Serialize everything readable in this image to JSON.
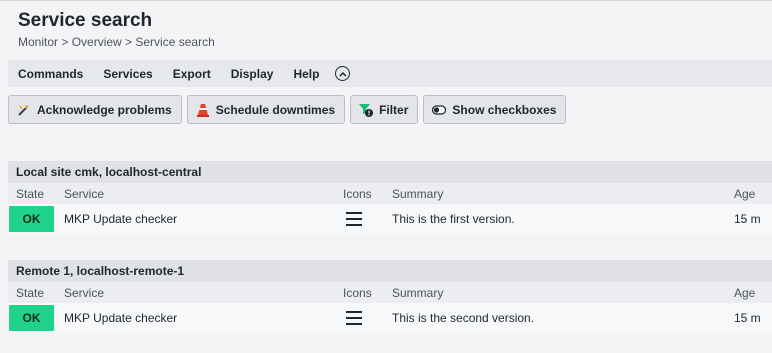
{
  "page": {
    "title": "Service search",
    "breadcrumb": "Monitor > Overview > Service search"
  },
  "menu": {
    "items": [
      "Commands",
      "Services",
      "Export",
      "Display",
      "Help"
    ],
    "collapse_icon": "chevron-up-circle-icon"
  },
  "toolbar": {
    "buttons": [
      {
        "label": "Acknowledge problems",
        "icon": "acknowledge-icon"
      },
      {
        "label": "Schedule downtimes",
        "icon": "traffic-cone-icon"
      },
      {
        "label": "Filter",
        "icon": "filter-icon"
      },
      {
        "label": "Show checkboxes",
        "icon": "toggle-icon"
      }
    ]
  },
  "columns": {
    "state": "State",
    "service": "Service",
    "icons": "Icons",
    "summary": "Summary",
    "age": "Age"
  },
  "groups": [
    {
      "title": "Local site cmk, localhost-central",
      "rows": [
        {
          "state": "OK",
          "service": "MKP Update checker",
          "summary": "This is the first version.",
          "age": "15 m"
        }
      ]
    },
    {
      "title": "Remote 1, localhost-remote-1",
      "rows": [
        {
          "state": "OK",
          "service": "MKP Update checker",
          "summary": "This is the second version.",
          "age": "15 m"
        }
      ]
    }
  ],
  "colors": {
    "ok": "#1fd48a",
    "background": "#f4f4f6",
    "menubar": "#e6e8ec"
  }
}
